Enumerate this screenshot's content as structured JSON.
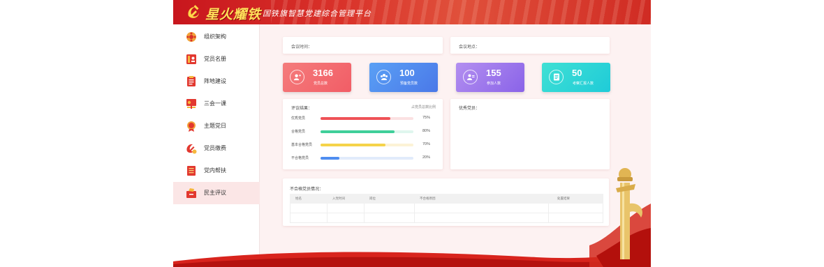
{
  "header": {
    "title": "星火耀铁",
    "subtitle": "国铁旗智慧党建综合管理平台"
  },
  "sidebar": {
    "items": [
      {
        "label": "组织架构",
        "icon": "org-structure-icon"
      },
      {
        "label": "党员名册",
        "icon": "member-roster-icon"
      },
      {
        "label": "阵地建设",
        "icon": "position-building-icon"
      },
      {
        "label": "三会一课",
        "icon": "meetings-lessons-icon"
      },
      {
        "label": "主题党日",
        "icon": "theme-party-day-icon"
      },
      {
        "label": "党员缴费",
        "icon": "party-dues-icon"
      },
      {
        "label": "党内帮扶",
        "icon": "party-assistance-icon"
      },
      {
        "label": "民主评议",
        "icon": "democratic-evaluation-icon"
      }
    ],
    "active_index": 7
  },
  "meeting": {
    "time_label": "会议时间：",
    "place_label": "会议地点："
  },
  "stats": [
    {
      "value": "3166",
      "label": "党员总数",
      "icon": "user-add-icon",
      "color_from": "#f47c7c",
      "color_to": "#f25d66"
    },
    {
      "value": "100",
      "label": "预备党员数",
      "icon": "group-icon",
      "color_from": "#5aa0f5",
      "color_to": "#4a78e8"
    },
    {
      "value": "155",
      "label": "参加人数",
      "icon": "users-icon",
      "color_from": "#b38ff0",
      "color_to": "#8a63e8"
    },
    {
      "value": "50",
      "label": "考察汇报人数",
      "icon": "report-icon",
      "color_from": "#3fe0d4",
      "color_to": "#1fcbd8"
    }
  ],
  "evaluation": {
    "title": "评议结果：",
    "link": "占党员总数比例",
    "rows": [
      {
        "label": "优秀党员",
        "percent": 75,
        "percent_text": "75%",
        "fill": "#ef5257",
        "track": "#fbe1e2"
      },
      {
        "label": "合格党员",
        "percent": 80,
        "percent_text": "80%",
        "fill": "#3fcf9a",
        "track": "#dff6ee"
      },
      {
        "label": "基本合格党员",
        "percent": 70,
        "percent_text": "70%",
        "fill": "#f5d34a",
        "track": "#fcf3d6"
      },
      {
        "label": "不合格党员",
        "percent": 20,
        "percent_text": "20%",
        "fill": "#4f8df0",
        "track": "#e1ebfb"
      }
    ]
  },
  "excellent": {
    "title": "优秀党员："
  },
  "unqualified": {
    "title": "不合格党员情况：",
    "columns": [
      "姓名",
      "入党时间",
      "岗位",
      "不合格原因",
      "处置结果"
    ]
  },
  "colors": {
    "brand_red": "#c8161d",
    "page_bg": "#fdf2f2",
    "active_nav": "#fbe6e6"
  }
}
